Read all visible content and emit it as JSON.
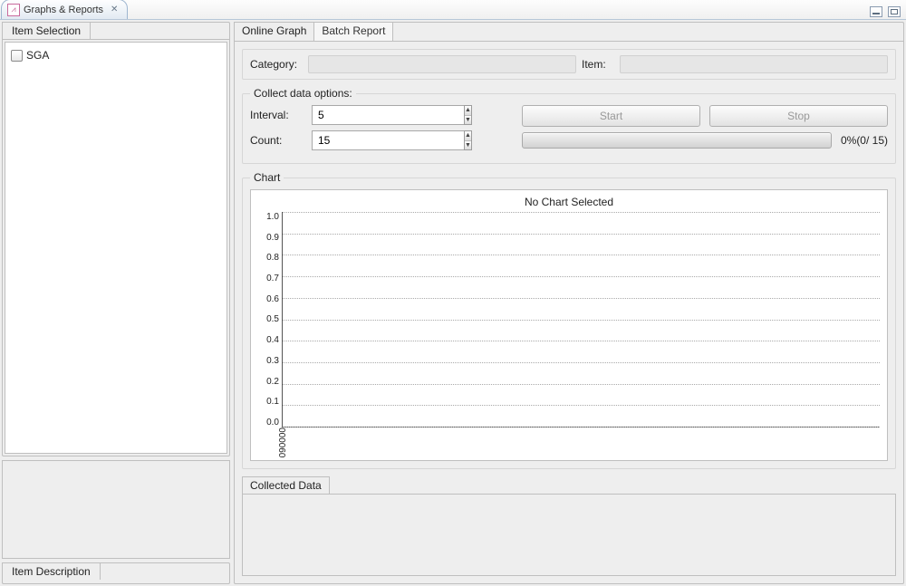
{
  "view": {
    "tab_title": "Graphs & Reports"
  },
  "left": {
    "item_selection_label": "Item Selection",
    "tree": [
      {
        "label": "SGA",
        "checked": false
      }
    ],
    "item_description_label": "Item Description"
  },
  "right": {
    "tabs": [
      {
        "label": "Online Graph",
        "active": true
      },
      {
        "label": "Batch Report",
        "active": false
      }
    ],
    "category_label": "Category:",
    "category_value": "",
    "item_label": "Item:",
    "item_value": "",
    "options": {
      "legend": "Collect data options:",
      "interval_label": "Interval:",
      "interval_value": "5",
      "count_label": "Count:",
      "count_value": "15",
      "start_label": "Start",
      "stop_label": "Stop",
      "progress_text": "0%(0/ 15)"
    },
    "chart": {
      "legend": "Chart",
      "title": "No Chart Selected"
    },
    "collected_data_label": "Collected Data"
  },
  "chart_data": {
    "type": "line",
    "title": "No Chart Selected",
    "xlabel": "",
    "ylabel": "",
    "ylim": [
      0.0,
      1.0
    ],
    "yticks": [
      "1.0",
      "0.9",
      "0.8",
      "0.7",
      "0.6",
      "0.5",
      "0.4",
      "0.3",
      "0.2",
      "0.1",
      "0.0"
    ],
    "xticks": [
      "090000"
    ],
    "series": []
  }
}
